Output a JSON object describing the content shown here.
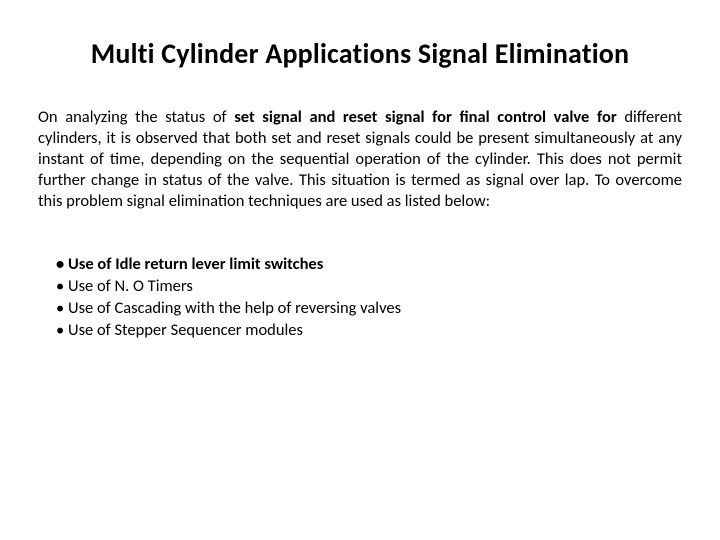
{
  "title": "Multi Cylinder Applications Signal Elimination",
  "para": {
    "lead": "On analyzing the status of ",
    "bold1": "set signal and reset signal for final control valve for",
    "rest": " different cylinders, it is observed that both set and reset signals could be present simultaneously at any instant of time, depending on the sequential operation of the cylinder. This does not permit further change in status of the valve. This situation is termed as signal over lap. To overcome this problem signal elimination techniques are used as listed below:"
  },
  "bullets": {
    "b1": "Use of Idle return lever limit switches",
    "b2": "Use of N. O Timers",
    "b3": "Use of Cascading with the help of reversing valves",
    "b4": "Use of Stepper Sequencer modules"
  },
  "dot": "•"
}
